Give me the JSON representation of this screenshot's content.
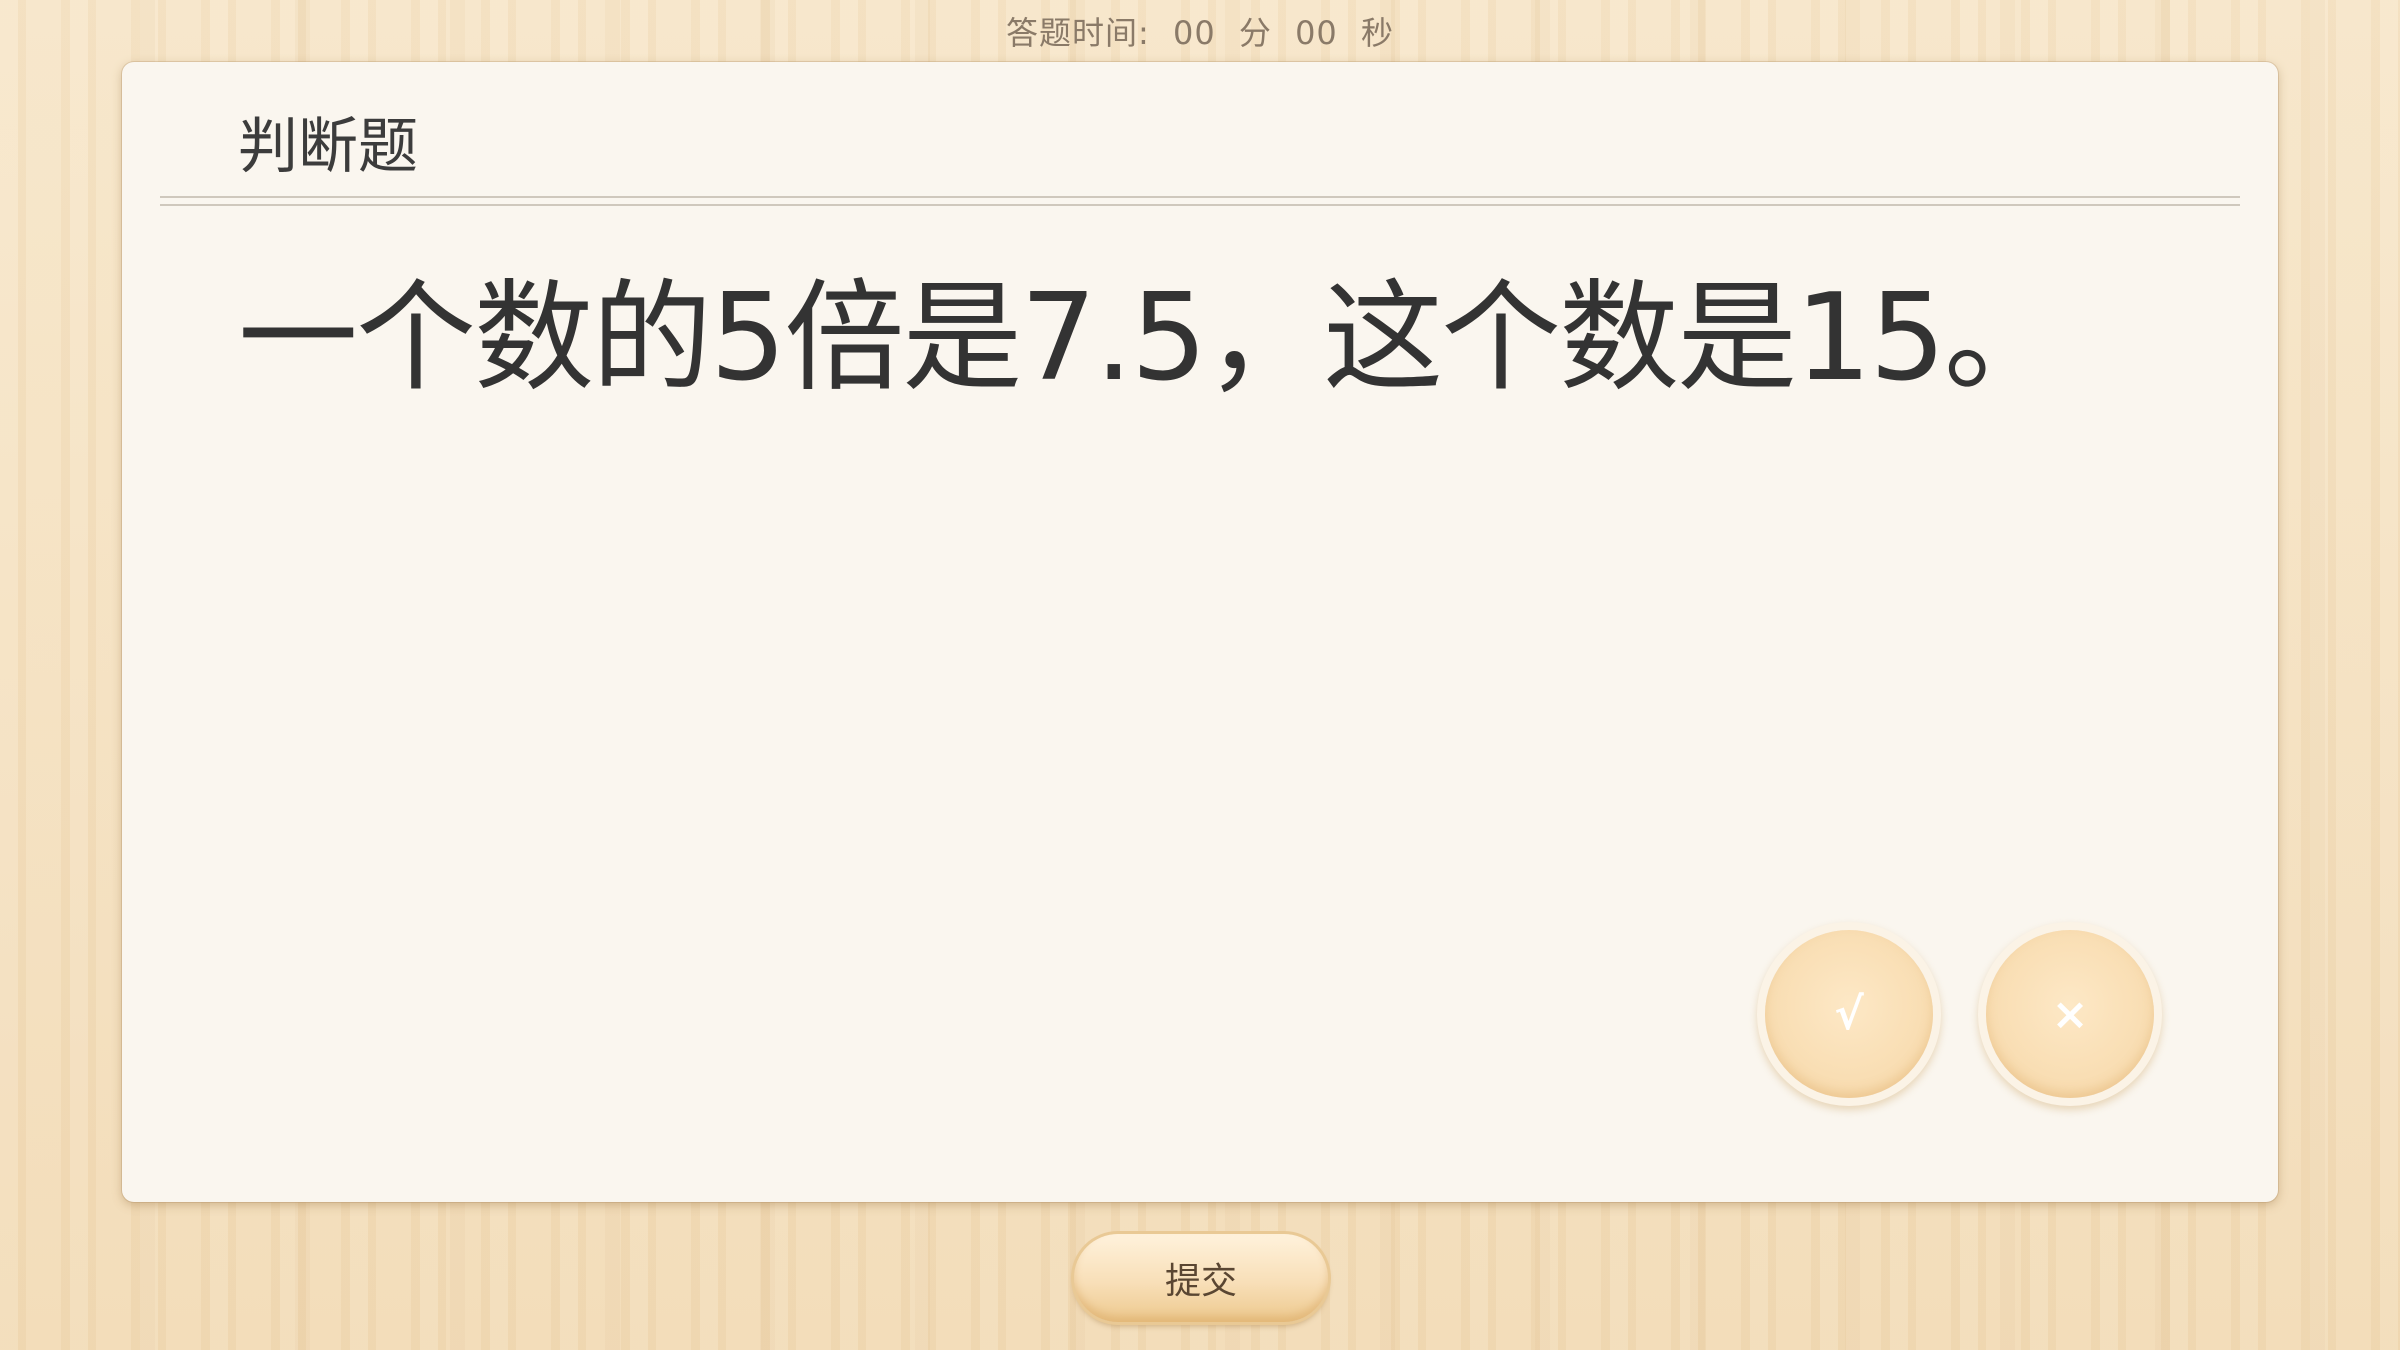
{
  "timer": {
    "label": "答题时间:",
    "minutes": "00",
    "minutes_unit": "分",
    "seconds": "00",
    "seconds_unit": "秒"
  },
  "question": {
    "type": "判断题",
    "text": "一个数的5倍是7.5，这个数是15。"
  },
  "answers": {
    "true_label": "√",
    "false_label": "×"
  },
  "actions": {
    "submit_label": "提交"
  },
  "colors": {
    "background": "#f4dfbd",
    "card": "#faf6ef",
    "answer_button": "#f8dcb0",
    "text": "#333333"
  }
}
